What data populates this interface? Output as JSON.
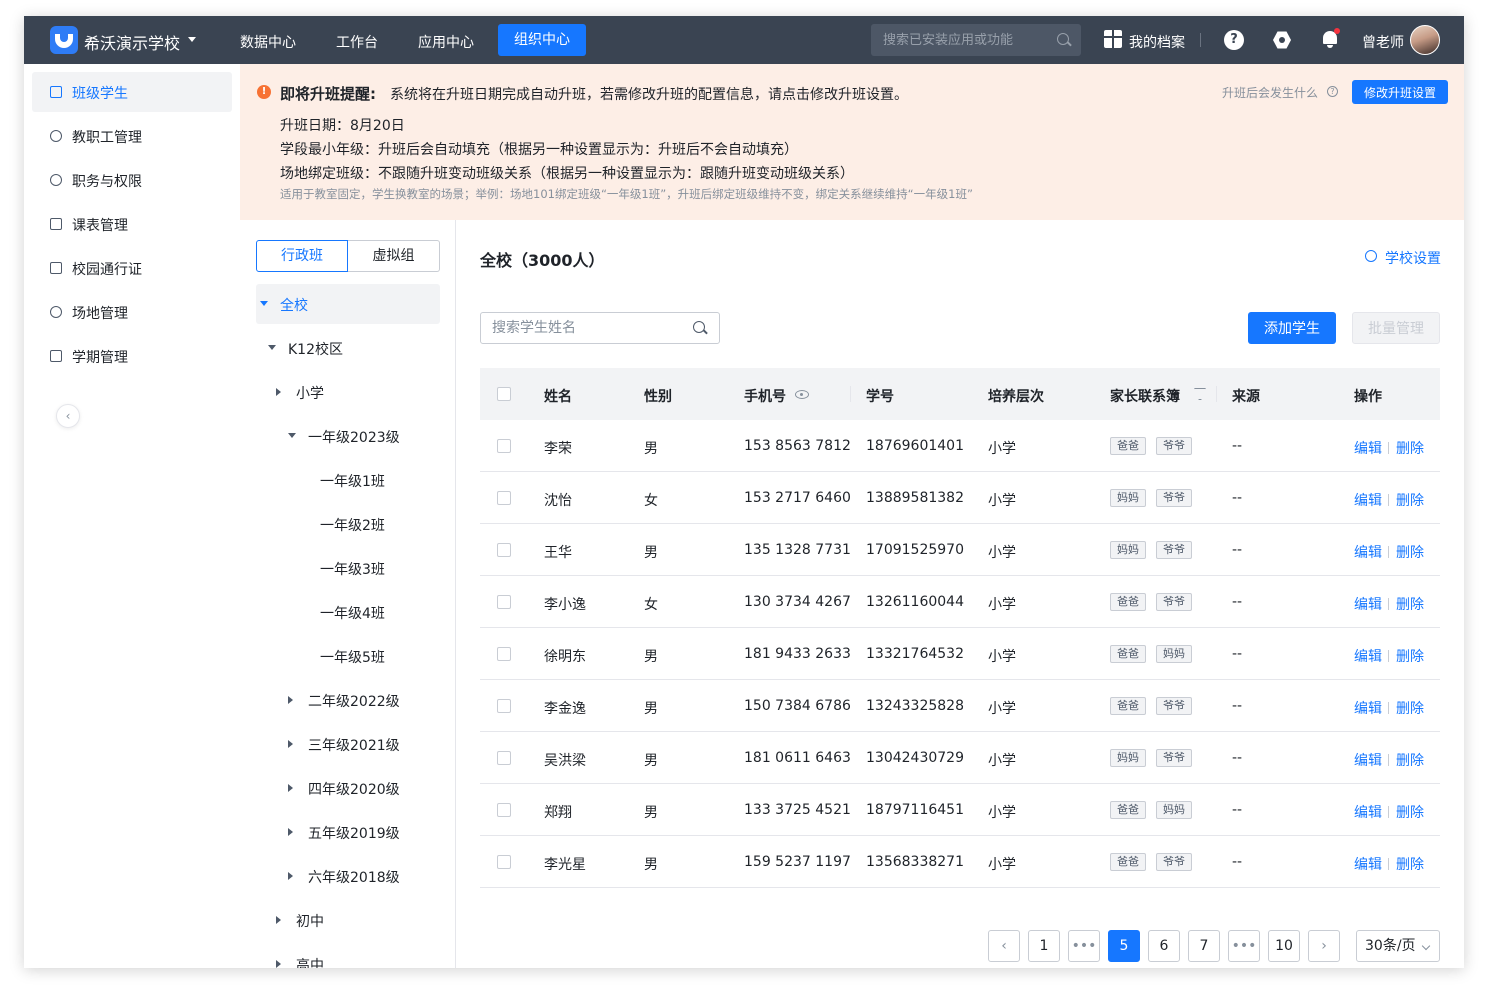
{
  "topnav": {
    "school_name": "希沃演示学校",
    "items": [
      "数据中心",
      "工作台",
      "应用中心",
      "组织中心"
    ],
    "active_item": "组织中心",
    "search_placeholder": "搜索已安装应用或功能",
    "archive_label": "我的档案",
    "user_name": "曾老师"
  },
  "sidebar": {
    "items": [
      {
        "label": "班级学生",
        "icon": "calendar-icon",
        "active": true
      },
      {
        "label": "教职工管理",
        "icon": "user-icon"
      },
      {
        "label": "职务与权限",
        "icon": "user-lock-icon"
      },
      {
        "label": "课表管理",
        "icon": "calendar-icon"
      },
      {
        "label": "校园通行证",
        "icon": "card-icon"
      },
      {
        "label": "场地管理",
        "icon": "location-icon"
      },
      {
        "label": "学期管理",
        "icon": "calendar-clock-icon"
      }
    ],
    "collapse_glyph": "‹"
  },
  "banner": {
    "title": "即将升班提醒:",
    "message": "系统将在升班日期完成自动升班，若需修改升班的配置信息，请点击修改升班设置。",
    "lines": [
      "升班日期：8月20日",
      "学段最小年级：升班后会自动填充（根据另一种设置显示为：升班后不会自动填充）",
      "场地绑定班级：不跟随升班变动班级关系（根据另一种设置显示为：跟随升班变动班级关系）"
    ],
    "note": "适用于教室固定，学生换教室的场景；举例：场地101绑定班级“一年级1班”，升班后绑定班级维持不变，绑定关系继续维持“一年级1班”",
    "help_text": "升班后会发生什么",
    "button_label": "修改升班设置",
    "accent_color": "#f77234"
  },
  "tree": {
    "segments": [
      "行政班",
      "虚拟组"
    ],
    "nodes": [
      {
        "label": "全校",
        "caret": "down",
        "selected": true
      },
      {
        "label": "K12校区",
        "caret": "down"
      },
      {
        "label": "小学",
        "caret": "right"
      },
      {
        "label": "一年级2023级",
        "caret": "down"
      },
      {
        "label": "一年级1班",
        "caret": ""
      },
      {
        "label": "一年级2班",
        "caret": ""
      },
      {
        "label": "一年级3班",
        "caret": ""
      },
      {
        "label": "一年级4班",
        "caret": ""
      },
      {
        "label": "一年级5班",
        "caret": ""
      },
      {
        "label": "二年级2022级",
        "caret": "right"
      },
      {
        "label": "三年级2021级",
        "caret": "right"
      },
      {
        "label": "四年级2020级",
        "caret": "right"
      },
      {
        "label": "五年级2019级",
        "caret": "right"
      },
      {
        "label": "六年级2018级",
        "caret": "right"
      },
      {
        "label": "初中",
        "caret": "right"
      },
      {
        "label": "高中",
        "caret": "right"
      }
    ]
  },
  "main": {
    "title": "全校（3000人）",
    "settings_label": "学校设置",
    "search_placeholder": "搜索学生姓名",
    "add_button": "添加学生",
    "batch_button": "批量管理"
  },
  "table": {
    "headers": [
      "姓名",
      "性别",
      "手机号",
      "学号",
      "培养层次",
      "家长联系簿",
      "来源",
      "操作"
    ],
    "rows": [
      {
        "name": "李荣",
        "gender": "男",
        "phone": "153 8563 7812",
        "id": "18769601401",
        "level": "小学",
        "tags": [
          "爸爸",
          "爷爷"
        ],
        "source": "--"
      },
      {
        "name": "沈怡",
        "gender": "女",
        "phone": "153 2717 6460",
        "id": "13889581382",
        "level": "小学",
        "tags": [
          "妈妈",
          "爷爷"
        ],
        "source": "--"
      },
      {
        "name": "王华",
        "gender": "男",
        "phone": "135 1328 7731",
        "id": "17091525970",
        "level": "小学",
        "tags": [
          "妈妈",
          "爷爷"
        ],
        "source": "--"
      },
      {
        "name": "李小逸",
        "gender": "女",
        "phone": "130 3734 4267",
        "id": "13261160044",
        "level": "小学",
        "tags": [
          "爸爸",
          "爷爷"
        ],
        "source": "--"
      },
      {
        "name": "徐明东",
        "gender": "男",
        "phone": "181 9433 2633",
        "id": "13321764532",
        "level": "小学",
        "tags": [
          "爸爸",
          "妈妈"
        ],
        "source": "--"
      },
      {
        "name": "李金逸",
        "gender": "男",
        "phone": "150 7384 6786",
        "id": "13243325828",
        "level": "小学",
        "tags": [
          "爸爸",
          "爷爷"
        ],
        "source": "--"
      },
      {
        "name": "吴洪梁",
        "gender": "男",
        "phone": "181 0611 6463",
        "id": "13042430729",
        "level": "小学",
        "tags": [
          "妈妈",
          "爷爷"
        ],
        "source": "--"
      },
      {
        "name": "郑翔",
        "gender": "男",
        "phone": "133 3725 4521",
        "id": "18797116451",
        "level": "小学",
        "tags": [
          "爸爸",
          "妈妈"
        ],
        "source": "--"
      },
      {
        "name": "李光星",
        "gender": "男",
        "phone": "159 5237 1197",
        "id": "13568338271",
        "level": "小学",
        "tags": [
          "爸爸",
          "爷爷"
        ],
        "source": "--"
      }
    ],
    "edit_label": "编辑",
    "delete_label": "删除"
  },
  "pagination": {
    "prev": "‹",
    "next": "›",
    "ellipsis": "•••",
    "pages": [
      "1",
      "•••",
      "5",
      "6",
      "7",
      "•••",
      "10"
    ],
    "current_page": "5",
    "page_size": "30条/页"
  },
  "colors": {
    "primary": "#1677ff",
    "topbar": "#3a4452",
    "banner_bg": "#fdeee6"
  }
}
